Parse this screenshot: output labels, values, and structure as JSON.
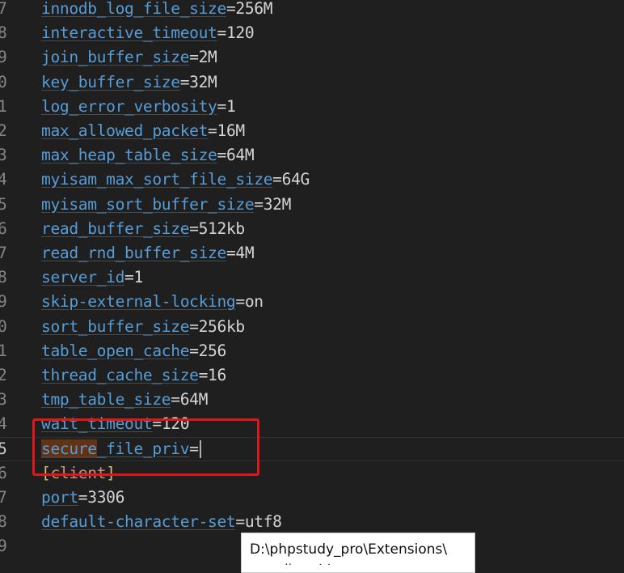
{
  "editor": {
    "lines": [
      {
        "num": "7",
        "key": "innodb_log_file_size",
        "value": "256M"
      },
      {
        "num": "8",
        "key": "interactive_timeout",
        "value": "120"
      },
      {
        "num": "9",
        "key": "join_buffer_size",
        "value": "2M"
      },
      {
        "num": "0",
        "key": "key_buffer_size",
        "value": "32M"
      },
      {
        "num": "1",
        "key": "log_error_verbosity",
        "value": "1"
      },
      {
        "num": "2",
        "key": "max_allowed_packet",
        "value": "16M"
      },
      {
        "num": "3",
        "key": "max_heap_table_size",
        "value": "64M"
      },
      {
        "num": "4",
        "key": "myisam_max_sort_file_size",
        "value": "64G"
      },
      {
        "num": "5",
        "key": "myisam_sort_buffer_size",
        "value": "32M"
      },
      {
        "num": "6",
        "key": "read_buffer_size",
        "value": "512kb"
      },
      {
        "num": "7",
        "key": "read_rnd_buffer_size",
        "value": "4M"
      },
      {
        "num": "8",
        "key": "server_id",
        "value": "1"
      },
      {
        "num": "9",
        "key": "skip-external-locking",
        "value": "on"
      },
      {
        "num": "0",
        "key": "sort_buffer_size",
        "value": "256kb"
      },
      {
        "num": "1",
        "key": "table_open_cache",
        "value": "256"
      },
      {
        "num": "2",
        "key": "thread_cache_size",
        "value": "16"
      },
      {
        "num": "3",
        "key": "tmp_table_size",
        "value": "64M"
      },
      {
        "num": "4",
        "key": "wait_timeout",
        "value": "120"
      },
      {
        "num": "5",
        "key": "secure_file_priv",
        "value": ""
      },
      {
        "num": "6",
        "section": "client"
      },
      {
        "num": "7",
        "key": "port",
        "value": "3306"
      },
      {
        "num": "8",
        "key": "default-character-set",
        "value": "utf8"
      },
      {
        "num": "9",
        "key": "",
        "value": ""
      }
    ],
    "current_line_index": 18,
    "highlighted_word": "secure"
  },
  "tooltip": {
    "path": "D:\\phpstudy_pro\\Extensions\\",
    "second_line": "…ㄧ  ㄦ ㄧ ㄚ"
  },
  "colors": {
    "background": "#1f1f1f",
    "key": "#569cd6",
    "value": "#d4d4d4",
    "section_bracket": "#d7ba7d",
    "annotation": "#e0161b"
  }
}
